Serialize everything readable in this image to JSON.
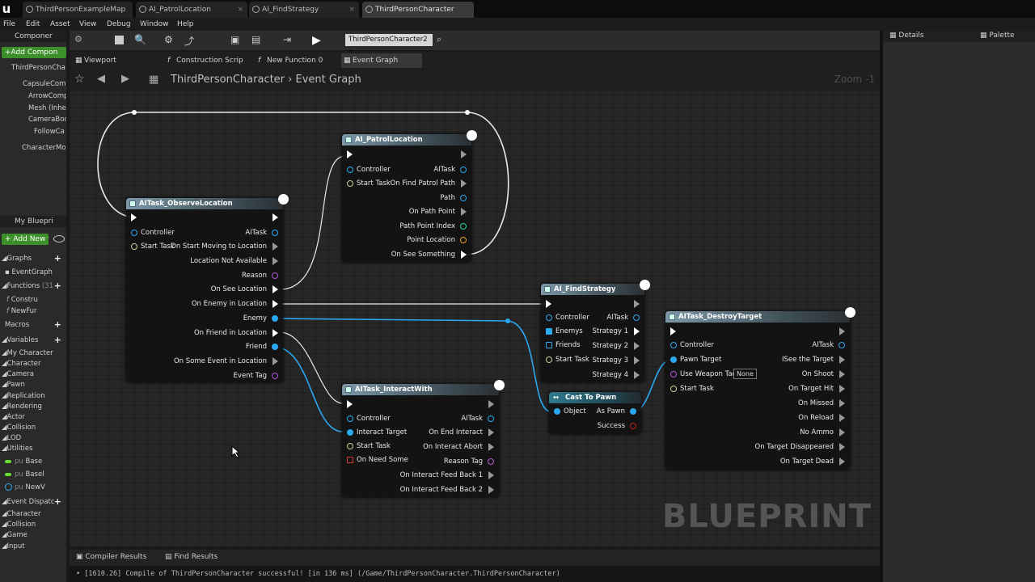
{
  "doc_tabs": [
    "ThirdPersonExampleMap",
    "AI_PatrolLocation",
    "AI_FindStrategy",
    "ThirdPersonCharacter"
  ],
  "menu": [
    "File",
    "Edit",
    "Asset",
    "View",
    "Debug",
    "Window",
    "Help"
  ],
  "left": {
    "components_header": "Componer",
    "add_component": "+Add Compon",
    "tree": [
      "ThirdPersonCha",
      "CapsuleCom",
      "ArrowComp",
      "Mesh (Inhe",
      "CameraBoo",
      "FollowCa",
      "CharacterMo"
    ],
    "myblueprint_header": "My Bluepri",
    "add_new": "Add New",
    "graphs": "Graphs",
    "eventgraph": "EventGraph",
    "functions": "Functions",
    "functions_count": "(31",
    "func_items": [
      "Constru",
      "NewFur"
    ],
    "macros": "Macros",
    "variables": "Variables",
    "var_categories": [
      "My Character",
      "Character",
      "Camera",
      "Pawn",
      "Replication",
      "Rendering",
      "Actor",
      "Collision",
      "LOD",
      "Utilities"
    ],
    "var_items": [
      "Base",
      "Basel",
      "NewV"
    ],
    "event_dispatchers": "Event Dispatc",
    "ed_categories": [
      "Character",
      "Collision",
      "Game",
      "Input"
    ],
    "pub_label": "pu"
  },
  "toolbar": {
    "class_dropdown": "ThirdPersonCharacter2"
  },
  "editor_tabs": [
    "Viewport",
    "Construction Scrip",
    "New Function 0",
    "Event Graph"
  ],
  "breadcrumb": {
    "root": "ThirdPersonCharacter",
    "sep": "›",
    "leaf": "Event Graph"
  },
  "zoom": "Zoom -1",
  "watermark": "BLUEPRINT",
  "nodes": {
    "observe": {
      "title": "AITask_ObserveLocation",
      "left": [
        "Controller",
        "Start Task"
      ],
      "right": [
        "AITask",
        "On Start Moving to Location",
        "Location Not Available",
        "Reason",
        "On See Location",
        "On Enemy in Location",
        "Enemy",
        "On Friend in Location",
        "Friend",
        "On Some Event in Location",
        "Event Tag"
      ]
    },
    "patrol": {
      "title": "AI_PatrolLocation",
      "left": [
        "Controller",
        "Start Task"
      ],
      "right": [
        "AITask",
        "On Find Patrol Path",
        "Path",
        "On Path Point",
        "Path Point Index",
        "Point Location",
        "On See Something"
      ]
    },
    "interact": {
      "title": "AITask_InteractWith",
      "left": [
        "Controller",
        "Interact Target",
        "Start Task",
        "On Need Some"
      ],
      "right": [
        "AITask",
        "On End Interact",
        "On Interact Abort",
        "Reason Tag",
        "On Interact Feed Back 1",
        "On Interact Feed Back 2"
      ]
    },
    "find": {
      "title": "AI_FindStrategy",
      "left": [
        "Controller",
        "Enemys",
        "Friends",
        "Start Task"
      ],
      "right": [
        "AITask",
        "Strategy 1",
        "Strategy 2",
        "Strategy 3",
        "Strategy 4"
      ]
    },
    "cast": {
      "title": "Cast To Pawn",
      "left": [
        "Object"
      ],
      "right": [
        "As Pawn",
        "Success"
      ]
    },
    "destroy": {
      "title": "AITask_DestroyTarget",
      "left": [
        "Controller",
        "Pawn Target",
        "Use Weapon Tag",
        "Start Task"
      ],
      "weapon_value": "None",
      "right": [
        "AITask",
        "ISee the Target",
        "On Shoot",
        "On Target Hit",
        "On Missed",
        "On Reload",
        "No Ammo",
        "On Target Disappeared",
        "On Target Dead"
      ]
    }
  },
  "bottom_tabs": [
    "Compiler Results",
    "Find Results"
  ],
  "log": "• [1610.26] Compile of ThirdPersonCharacter successful! [in 136 ms] (/Game/ThirdPersonCharacter.ThirdPersonCharacter)",
  "right_tabs": [
    "Details",
    "Palette"
  ]
}
